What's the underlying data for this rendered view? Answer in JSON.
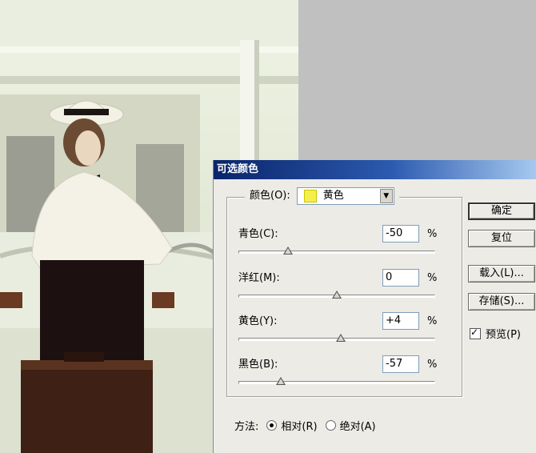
{
  "dialog": {
    "title": "可选颜色",
    "color_label": "颜色(O):",
    "color_value": "黄色",
    "color_swatch": "#f5ef4a",
    "sliders": [
      {
        "label": "青色(C):",
        "value": "-50",
        "unit": "%",
        "level": -50
      },
      {
        "label": "洋红(M):",
        "value": "0",
        "unit": "%",
        "level": 0
      },
      {
        "label": "黄色(Y):",
        "value": "+4",
        "unit": "%",
        "level": 4
      },
      {
        "label": "黑色(B):",
        "value": "-57",
        "unit": "%",
        "level": -57
      }
    ],
    "buttons": {
      "ok": "确定",
      "reset": "复位",
      "load": "载入(L)...",
      "save": "存储(S)..."
    },
    "preview_label": "预览(P)",
    "method_label": "方法:",
    "method_relative": "相对(R)",
    "method_absolute": "绝对(A)"
  }
}
